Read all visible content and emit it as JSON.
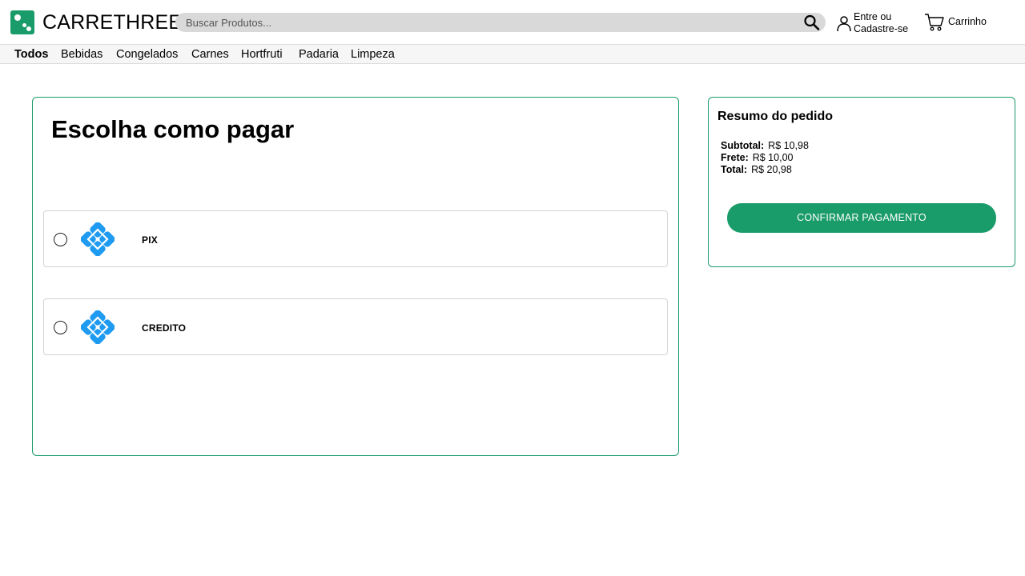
{
  "header": {
    "brand": "CARRETHREE",
    "search": {
      "placeholder": "Buscar Produtos..."
    },
    "account": {
      "line1": "Entre ou",
      "line2": "Cadastre-se"
    },
    "cart_label": "Carrinho"
  },
  "categories": [
    {
      "label": "Todos",
      "active": true
    },
    {
      "label": "Bebidas"
    },
    {
      "label": "Congelados"
    },
    {
      "label": "Carnes"
    },
    {
      "label": "Hortfruti"
    },
    {
      "label": "Padaria"
    },
    {
      "label": "Limpeza"
    }
  ],
  "payment": {
    "title": "Escolha como pagar",
    "options": [
      {
        "label": "PIX",
        "icon": "pix-icon"
      },
      {
        "label": "CREDITO",
        "icon": "pix-icon"
      }
    ]
  },
  "summary": {
    "title": "Resumo do pedido",
    "subtotal_label": "Subtotal:",
    "subtotal_value": "R$ 10,98",
    "frete_label": "Frete:",
    "frete_value": "R$ 10,00",
    "total_label": "Total:",
    "total_value": "R$ 20,98",
    "confirm_label": "CONFIRMAR PAGAMENTO"
  },
  "colors": {
    "brand_green": "#1a9b6a",
    "pix_blue": "#1e9bf0",
    "search_bg": "#d9d9d9"
  }
}
